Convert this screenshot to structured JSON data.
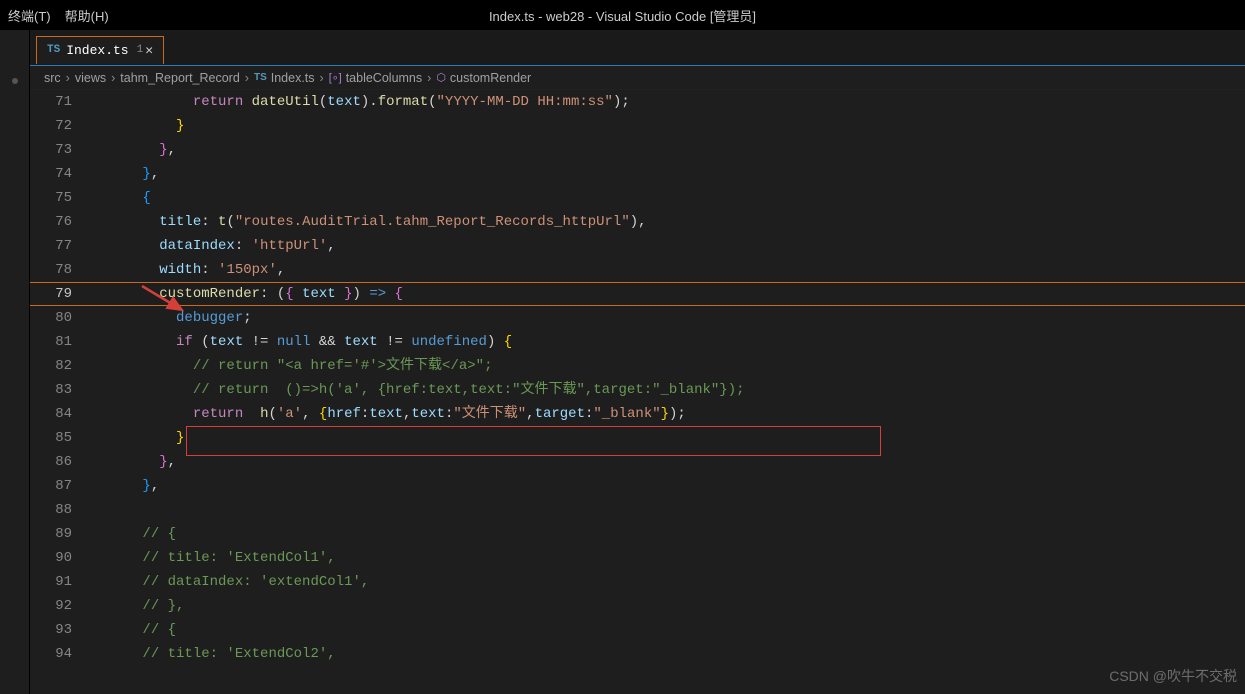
{
  "window_title": "Index.ts - web28 - Visual Studio Code [管理员]",
  "menu": {
    "terminal": "终端(T)",
    "help": "帮助(H)"
  },
  "tab": {
    "icon_text": "TS",
    "label": "Index.ts",
    "modified_badge": "1",
    "close": "✕"
  },
  "breadcrumbs": {
    "seg1": "src",
    "seg2": "views",
    "seg3": "tahm_Report_Record",
    "seg4_icon": "TS",
    "seg4": "Index.ts",
    "seg5": "tableColumns",
    "seg6": "customRender",
    "sep": "›"
  },
  "lines": [
    {
      "n": "71",
      "html": "            <span class='c-control'>return</span> <span class='c-func'>dateUtil</span>(<span class='c-var'>text</span>).<span class='c-func'>format</span>(<span class='c-string'>\"YYYY-MM-DD HH:mm:ss\"</span>);"
    },
    {
      "n": "72",
      "html": "          <span class='c-brace'>}</span>"
    },
    {
      "n": "73",
      "html": "        <span class='c-brace2'>}</span>,"
    },
    {
      "n": "74",
      "html": "      <span class='c-brace3'>}</span>,"
    },
    {
      "n": "75",
      "html": "      <span class='c-brace3'>{</span>"
    },
    {
      "n": "76",
      "html": "        <span class='c-var'>title</span>: <span class='c-func'>t</span>(<span class='c-string'>\"routes.AuditTrial.tahm_Report_Records_httpUrl\"</span>),"
    },
    {
      "n": "77",
      "html": "        <span class='c-var'>dataIndex</span>: <span class='c-string'>'httpUrl'</span>,"
    },
    {
      "n": "78",
      "html": "        <span class='c-var'>width</span>: <span class='c-string'>'150px'</span>,"
    },
    {
      "n": "79",
      "html": "        <span class='c-func'>customRender</span>: (<span class='c-brace2'>{</span> <span class='c-var'>text</span> <span class='c-brace2'>}</span>) <span class='c-keyword'>=&gt;</span> <span class='c-brace2'>{</span>",
      "active": true
    },
    {
      "n": "80",
      "html": "          <span class='c-keyword'>debugger</span>;"
    },
    {
      "n": "81",
      "html": "          <span class='c-control'>if</span> (<span class='c-var'>text</span> != <span class='c-keyword'>null</span> <span class='c-punct'>&&</span> <span class='c-var'>text</span> != <span class='c-keyword'>undefined</span>) <span class='c-brace'>{</span>"
    },
    {
      "n": "82",
      "html": "            <span class='c-comment'>// return \"&lt;a href='#'&gt;文件下载&lt;/a&gt;\";</span>"
    },
    {
      "n": "83",
      "html": "            <span class='c-comment'>// return  ()=&gt;h('a', {href:text,text:\"文件下载\",target:\"_blank\"});</span>"
    },
    {
      "n": "84",
      "html": "            <span class='c-control'>return</span>  <span class='c-func'>h</span>(<span class='c-string'>'a'</span>, <span class='c-brace'>{</span><span class='c-var'>href</span>:<span class='c-var'>text</span>,<span class='c-var'>text</span>:<span class='c-string'>\"文件下载\"</span>,<span class='c-var'>target</span>:<span class='c-string'>\"_blank\"</span><span class='c-brace'>}</span>);"
    },
    {
      "n": "85",
      "html": "          <span class='c-brace'>}</span>"
    },
    {
      "n": "86",
      "html": "        <span class='c-brace2'>}</span>,"
    },
    {
      "n": "87",
      "html": "      <span class='c-brace3'>}</span>,"
    },
    {
      "n": "88",
      "html": ""
    },
    {
      "n": "89",
      "html": "      <span class='c-comment'>// {</span>"
    },
    {
      "n": "90",
      "html": "      <span class='c-comment'>// title: 'ExtendCol1',</span>"
    },
    {
      "n": "91",
      "html": "      <span class='c-comment'>// dataIndex: 'extendCol1',</span>"
    },
    {
      "n": "92",
      "html": "      <span class='c-comment'>// },</span>"
    },
    {
      "n": "93",
      "html": "      <span class='c-comment'>// {</span>"
    },
    {
      "n": "94",
      "html": "      <span class='c-comment'>// title: 'ExtendCol2',</span>"
    }
  ],
  "watermark": "CSDN @吹牛不交税"
}
